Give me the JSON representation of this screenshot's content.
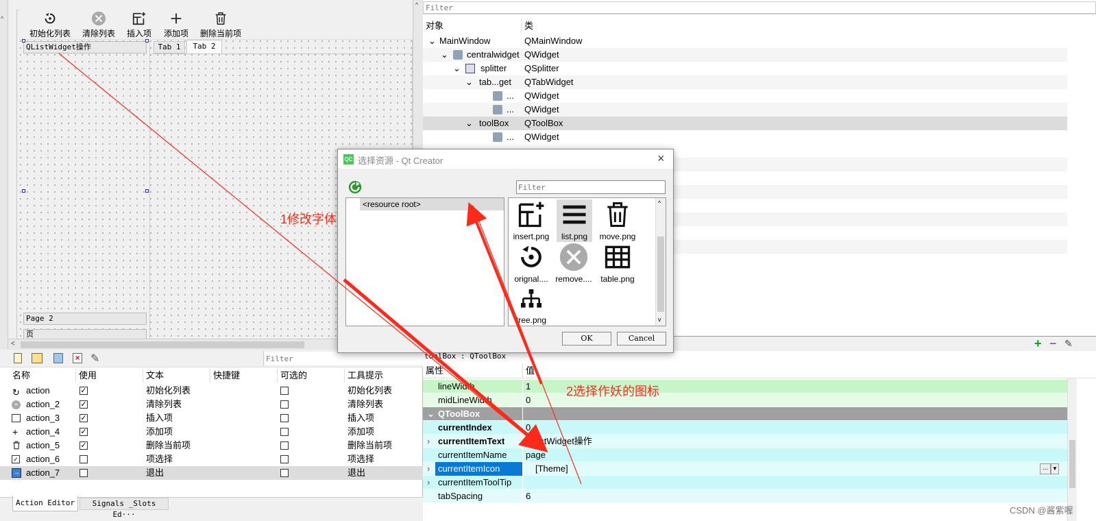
{
  "toolbar": {
    "buttons": [
      {
        "label": "初始化列表",
        "icon": "refresh-circle-icon"
      },
      {
        "label": "清除列表",
        "icon": "remove-circle-icon"
      },
      {
        "label": "插入项",
        "icon": "insert-icon"
      },
      {
        "label": "添加项",
        "icon": "plus-icon"
      },
      {
        "label": "删除当前项",
        "icon": "trash-icon"
      }
    ]
  },
  "form": {
    "toolbox_page1": "QListWidget操作",
    "toolbox_page2": "Page 2",
    "toolbox_page3": "页",
    "tab1": "Tab 1",
    "tab2": "Tab 2"
  },
  "object_inspector": {
    "filter_placeholder": "Filter",
    "col_object": "对象",
    "col_class": "类",
    "rows": [
      {
        "obj": "MainWindow",
        "cls": "QMainWindow"
      },
      {
        "obj": "centralwidget",
        "cls": "QWidget"
      },
      {
        "obj": "splitter",
        "cls": "QSplitter"
      },
      {
        "obj": "tab...get",
        "cls": "QTabWidget"
      },
      {
        "obj": "...",
        "cls": "QWidget"
      },
      {
        "obj": "...",
        "cls": "QWidget"
      },
      {
        "obj": "toolBox",
        "cls": "QToolBox"
      },
      {
        "obj": "...",
        "cls": "QWidget"
      }
    ]
  },
  "dialog": {
    "title": "选择资源 - Qt Creator",
    "filter_placeholder": "Filter",
    "tree_root": "<resource root>",
    "files": [
      {
        "name": "insert.png",
        "icon": "insert-icon"
      },
      {
        "name": "list.png",
        "icon": "list-icon"
      },
      {
        "name": "move.png",
        "icon": "trash-icon"
      },
      {
        "name": "orignal....",
        "icon": "refresh-circle-icon"
      },
      {
        "name": "remove....",
        "icon": "remove-circle-icon"
      },
      {
        "name": "table.png",
        "icon": "table-icon"
      },
      {
        "name": "tree.png",
        "icon": "tree-icon"
      }
    ],
    "ok": "OK",
    "cancel": "Cancel"
  },
  "action_editor": {
    "filter_placeholder": "Filter",
    "headers": [
      "名称",
      "使用",
      "文本",
      "快捷键",
      "可选的",
      "工具提示"
    ],
    "rows": [
      {
        "name": "action",
        "used": true,
        "text": "初始化列表",
        "tip": "初始化列表"
      },
      {
        "name": "action_2",
        "used": true,
        "text": "清除列表",
        "tip": "清除列表"
      },
      {
        "name": "action_3",
        "used": true,
        "text": "插入项",
        "tip": "插入项"
      },
      {
        "name": "action_4",
        "used": true,
        "text": "添加项",
        "tip": "添加项"
      },
      {
        "name": "action_5",
        "used": true,
        "text": "删除当前项",
        "tip": "删除当前项"
      },
      {
        "name": "action_6",
        "used": false,
        "text": "项选择",
        "tip": "项选择"
      },
      {
        "name": "action_7",
        "used": false,
        "text": "退出",
        "tip": "退出"
      }
    ],
    "tabs": [
      "Action Editor",
      "Signals _Slots Ed···"
    ]
  },
  "property_editor": {
    "header_object": "toolBox : QToolBox",
    "col_prop": "属性",
    "col_val": "值",
    "rows": [
      {
        "name": "lineWidth",
        "value": "1",
        "bold": false,
        "color": "#c8f5c8"
      },
      {
        "name": "midLineWidth",
        "value": "0",
        "bold": false,
        "color": "#e6fbe6"
      },
      {
        "name": "QToolBox",
        "value": "",
        "bold": true,
        "section": true,
        "color": "#a0a0a0"
      },
      {
        "name": "currentIndex",
        "value": "0",
        "bold": true,
        "color": "#c8f8f8"
      },
      {
        "name": "currentItemText",
        "value": "QListWidget操作",
        "bold": true,
        "color": "#e2fcfc"
      },
      {
        "name": "currentItemName",
        "value": "page",
        "bold": false,
        "color": "#c8f8f8"
      },
      {
        "name": "currentItemIcon",
        "value": "[Theme]",
        "bold": false,
        "selected": true,
        "color": "#e2fcfc"
      },
      {
        "name": "currentItemToolTip",
        "value": "",
        "bold": false,
        "color": "#c8f8f8"
      },
      {
        "name": "tabSpacing",
        "value": "6",
        "bold": false,
        "color": "#e2fcfc"
      }
    ],
    "value_button": "..."
  },
  "annotations": {
    "note1": "1修改字体",
    "note2": "2选择作妖的图标",
    "color": "#ff2a1a"
  },
  "watermark": "CSDN @酱紫喔"
}
